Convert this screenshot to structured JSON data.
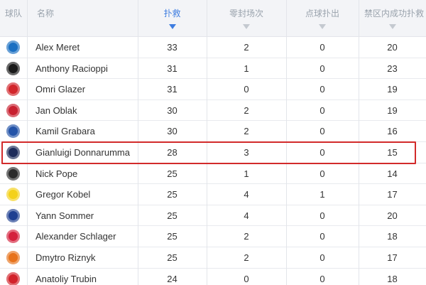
{
  "headers": {
    "team": "球队",
    "name": "名称",
    "saves": "扑救",
    "clean_sheets": "零封场次",
    "penalty_saves": "点球扑出",
    "box_saves": "禁区内成功扑救"
  },
  "sort_column": "saves",
  "rows": [
    {
      "club": "napoli",
      "crest_color": "#1a6fc2",
      "name": "Alex Meret",
      "saves": "33",
      "clean_sheets": "2",
      "penalty_saves": "0",
      "box_saves": "20"
    },
    {
      "club": "young-boys",
      "crest_color": "#1a1a1a",
      "name": "Anthony Racioppi",
      "saves": "31",
      "clean_sheets": "1",
      "penalty_saves": "0",
      "box_saves": "23"
    },
    {
      "club": "crvena-zvezda",
      "crest_color": "#d2262b",
      "name": "Omri Glazer",
      "saves": "31",
      "clean_sheets": "0",
      "penalty_saves": "0",
      "box_saves": "19"
    },
    {
      "club": "atletico",
      "crest_color": "#c8202f",
      "name": "Jan Oblak",
      "saves": "30",
      "clean_sheets": "2",
      "penalty_saves": "0",
      "box_saves": "19"
    },
    {
      "club": "copenhagen",
      "crest_color": "#2353a8",
      "name": "Kamil Grabara",
      "saves": "30",
      "clean_sheets": "2",
      "penalty_saves": "0",
      "box_saves": "16"
    },
    {
      "club": "psg",
      "crest_color": "#1d2b5a",
      "name": "Gianluigi Donnarumma",
      "saves": "28",
      "clean_sheets": "3",
      "penalty_saves": "0",
      "box_saves": "15"
    },
    {
      "club": "newcastle",
      "crest_color": "#2b2b2b",
      "name": "Nick Pope",
      "saves": "25",
      "clean_sheets": "1",
      "penalty_saves": "0",
      "box_saves": "14"
    },
    {
      "club": "dortmund",
      "crest_color": "#f4d11a",
      "name": "Gregor Kobel",
      "saves": "25",
      "clean_sheets": "4",
      "penalty_saves": "1",
      "box_saves": "17"
    },
    {
      "club": "inter",
      "crest_color": "#1f3f91",
      "name": "Yann Sommer",
      "saves": "25",
      "clean_sheets": "4",
      "penalty_saves": "0",
      "box_saves": "20"
    },
    {
      "club": "leipzig",
      "crest_color": "#d4213d",
      "name": "Alexander Schlager",
      "saves": "25",
      "clean_sheets": "2",
      "penalty_saves": "0",
      "box_saves": "18"
    },
    {
      "club": "shakhtar",
      "crest_color": "#e7731c",
      "name": "Dmytro Riznyk",
      "saves": "25",
      "clean_sheets": "2",
      "penalty_saves": "0",
      "box_saves": "17"
    },
    {
      "club": "benfica",
      "crest_color": "#d2222a",
      "name": "Anatoliy Trubin",
      "saves": "24",
      "clean_sheets": "0",
      "penalty_saves": "0",
      "box_saves": "18"
    }
  ],
  "highlighted_row": "Gianluigi Donnarumma",
  "colors": {
    "highlight_border": "#d22a2a",
    "sort_active": "#3e7de0",
    "header_bg": "#f3f4f7"
  }
}
